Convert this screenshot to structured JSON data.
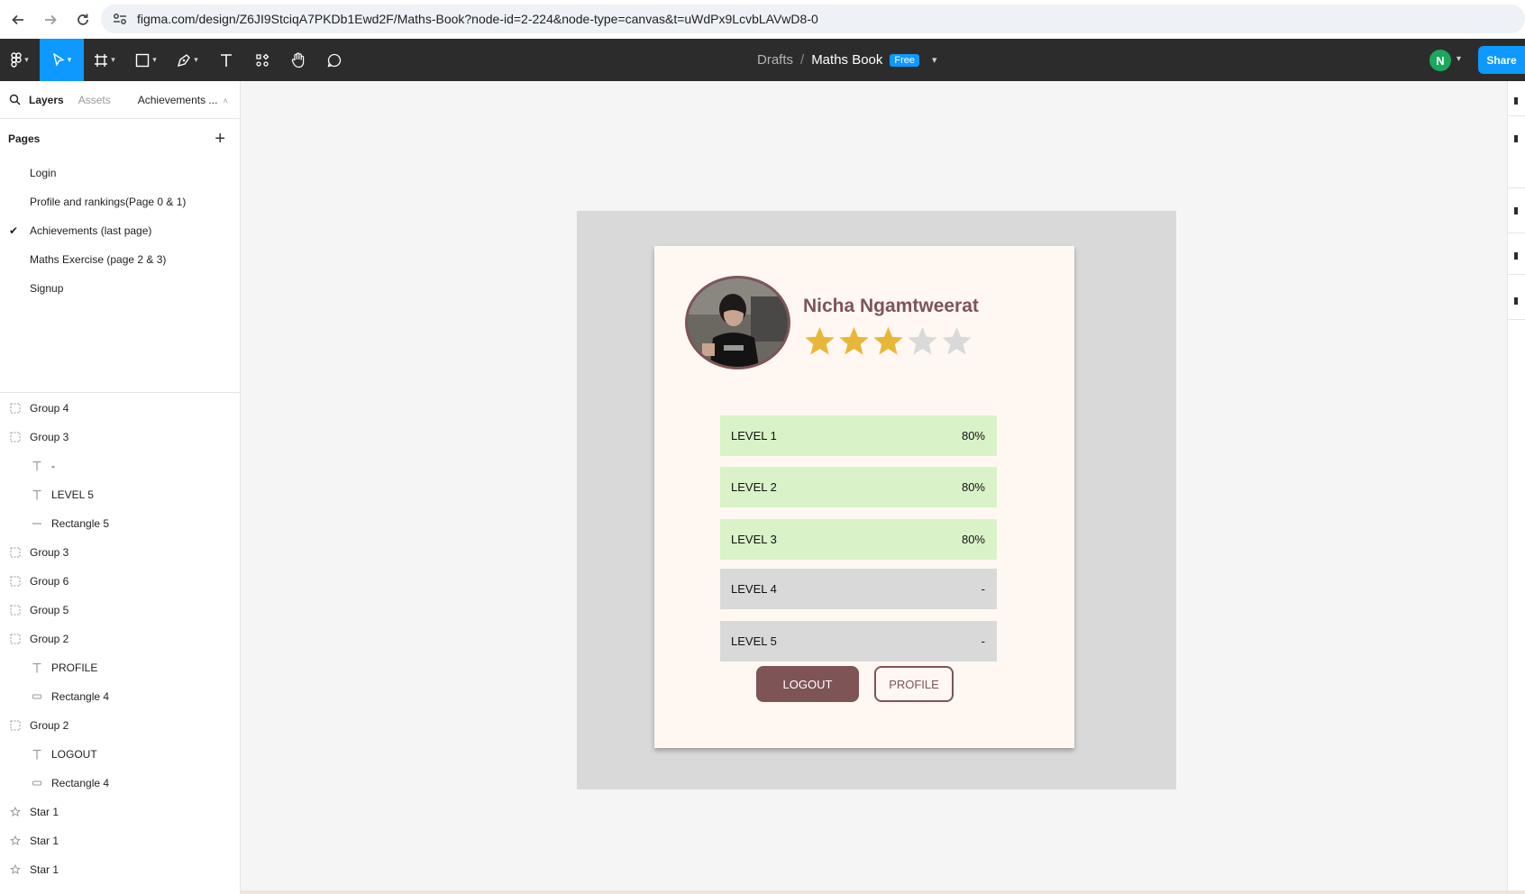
{
  "browser": {
    "url": "figma.com/design/Z6JI9StciqA7PKDb1Ewd2F/Maths-Book?node-id=2-224&node-type=canvas&t=uWdPx9LcvbLAVwD8-0"
  },
  "toolbar": {
    "breadcrumb_root": "Drafts",
    "breadcrumb_sep": "/",
    "file_name": "Maths Book",
    "plan_badge": "Free",
    "user_initial": "N",
    "share_label": "Share",
    "accent_color": "#0d99ff"
  },
  "left_panel": {
    "tabs": {
      "layers": "Layers",
      "assets": "Assets",
      "current_page": "Achievements ..."
    },
    "pages_header": "Pages",
    "pages": [
      {
        "label": "Login",
        "selected": false
      },
      {
        "label": "Profile and rankings(Page 0 & 1)",
        "selected": false
      },
      {
        "label": "Achievements (last page)",
        "selected": true
      },
      {
        "label": "Maths Exercise (page 2 & 3)",
        "selected": false
      },
      {
        "label": "Signup",
        "selected": false
      }
    ],
    "layers": [
      {
        "name": "Group 4",
        "type": "group",
        "indent": 0
      },
      {
        "name": "Group 3",
        "type": "group",
        "indent": 0
      },
      {
        "name": "-",
        "type": "text",
        "indent": 1
      },
      {
        "name": "LEVEL 5",
        "type": "text",
        "indent": 1
      },
      {
        "name": "Rectangle 5",
        "type": "line",
        "indent": 1
      },
      {
        "name": "Group 3",
        "type": "group",
        "indent": 0
      },
      {
        "name": "Group 6",
        "type": "group",
        "indent": 0
      },
      {
        "name": "Group 5",
        "type": "group",
        "indent": 0
      },
      {
        "name": "Group 2",
        "type": "group",
        "indent": 0
      },
      {
        "name": "PROFILE",
        "type": "text",
        "indent": 1
      },
      {
        "name": "Rectangle 4",
        "type": "rect",
        "indent": 1
      },
      {
        "name": "Group 2",
        "type": "group",
        "indent": 0
      },
      {
        "name": "LOGOUT",
        "type": "text",
        "indent": 1
      },
      {
        "name": "Rectangle 4",
        "type": "rect",
        "indent": 1
      },
      {
        "name": "Star 1",
        "type": "star",
        "indent": 0
      },
      {
        "name": "Star 1",
        "type": "star",
        "indent": 0
      },
      {
        "name": "Star 1",
        "type": "star",
        "indent": 0
      }
    ]
  },
  "design": {
    "user_name": "Nicha Ngamtweerat",
    "rating": 3,
    "rating_max": 5,
    "star_color": "#e8b739",
    "star_empty_color": "#d9d9d9",
    "brand_color": "#7e5456",
    "levels": [
      {
        "label": "LEVEL 1",
        "score": "80%",
        "completed": true
      },
      {
        "label": "LEVEL 2",
        "score": "80%",
        "completed": true
      },
      {
        "label": "LEVEL 3",
        "score": "80%",
        "completed": true
      },
      {
        "label": "LEVEL 4",
        "score": "-",
        "completed": false
      },
      {
        "label": "LEVEL 5",
        "score": "-",
        "completed": false
      }
    ],
    "completed_color": "#d9f2c8",
    "locked_color": "#d9d9d9",
    "logout_label": "LOGOUT",
    "profile_label": "PROFILE"
  }
}
